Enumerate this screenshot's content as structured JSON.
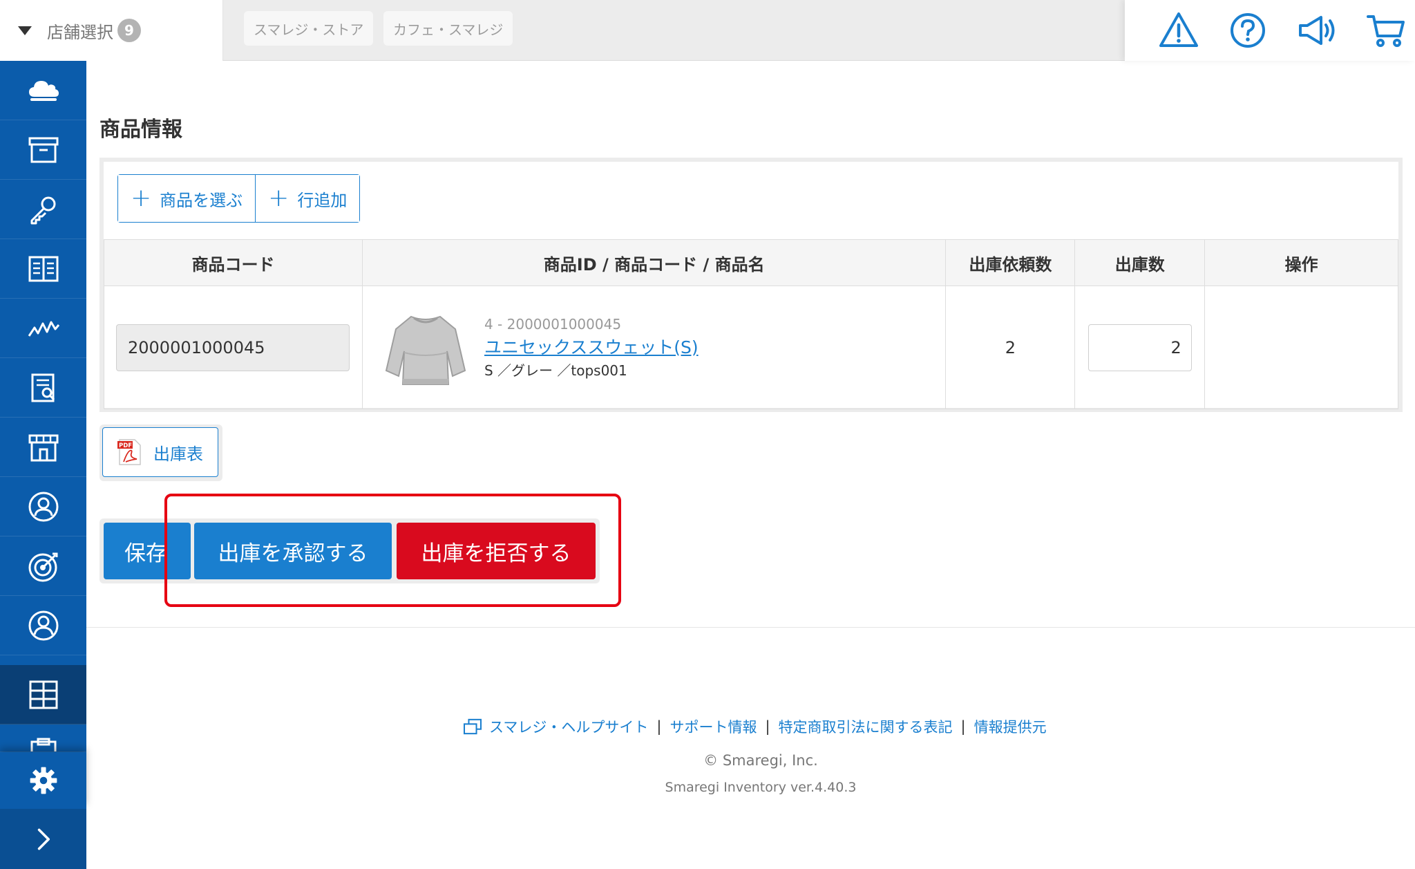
{
  "header": {
    "store_select_label": "店舗選択",
    "store_count": "9",
    "stores": [
      "スマレジ・ストア",
      "カフェ・スマレジ"
    ],
    "icons": [
      "warning-icon",
      "help-icon",
      "megaphone-icon",
      "cart-icon"
    ]
  },
  "sidebar": {
    "items": [
      "cloud-icon",
      "archive-box-icon",
      "key-icon",
      "book-icon",
      "chart-line-icon",
      "report-icon",
      "store-icon",
      "user-circle-icon",
      "target-icon",
      "user-icon",
      "grid-icon",
      "clipboard-icon"
    ],
    "active_item": "grid-icon",
    "bottom": [
      "gear-icon",
      "chevron-right-icon"
    ]
  },
  "main": {
    "section_title": "商品情報",
    "select_product_label": "商品を選ぶ",
    "add_row_label": "行追加",
    "table": {
      "headers": [
        "商品コード",
        "商品ID / 商品コード / 商品名",
        "出庫依頼数",
        "出庫数",
        "操作"
      ],
      "rows": [
        {
          "code": "2000001000045",
          "product_id_code": "4 - 2000001000045",
          "product_name": "ユニセックススウェット(S)",
          "attributes": "S ／グレー ／tops001",
          "requested_qty": "2",
          "shipped_qty": "2"
        }
      ]
    },
    "pdf_label": "出庫表",
    "save_label": "保存",
    "approve_label": "出庫を承認する",
    "reject_label": "出庫を拒否する"
  },
  "footer": {
    "links": [
      "スマレジ・ヘルプサイト",
      "サポート情報",
      "特定商取引法に関する表記",
      "情報提供元"
    ],
    "copyright": "© Smaregi, Inc.",
    "version": "Smaregi Inventory ver.4.40.3"
  },
  "colors": {
    "sidebar": "#0b5cab",
    "sidebar_active": "#0a3f75",
    "primary": "#1a7fcf",
    "danger": "#d90a1e",
    "highlight": "#e60012"
  }
}
